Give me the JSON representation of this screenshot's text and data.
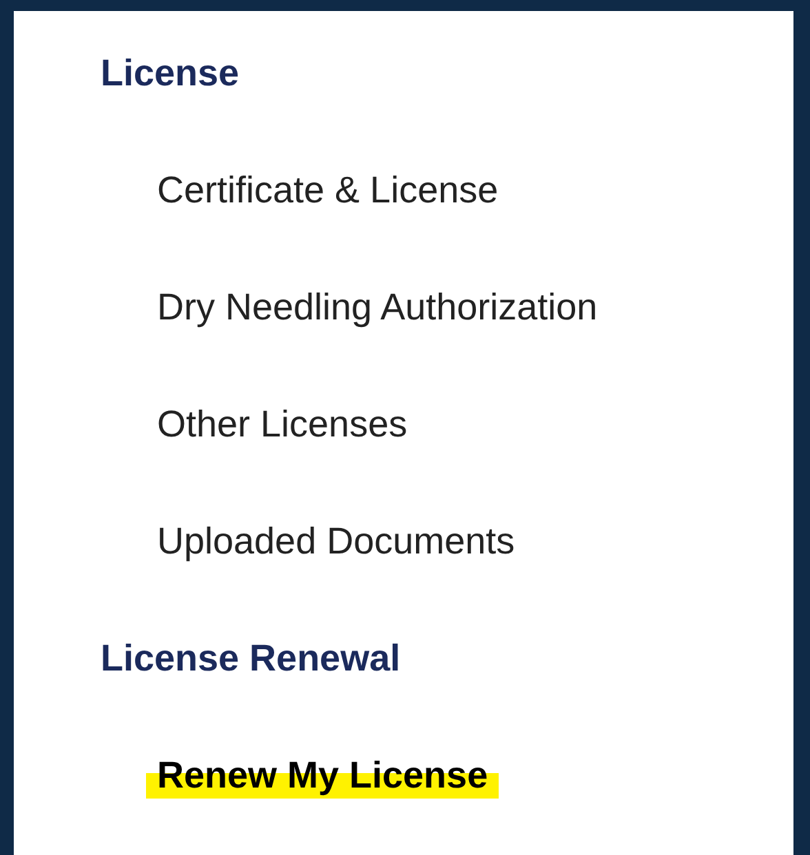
{
  "sections": [
    {
      "heading": "License",
      "items": [
        {
          "label": "Certificate & License",
          "selected": false,
          "highlighted": false
        },
        {
          "label": "Dry Needling Authorization",
          "selected": false,
          "highlighted": false
        },
        {
          "label": "Other Licenses",
          "selected": false,
          "highlighted": false
        },
        {
          "label": "Uploaded Documents",
          "selected": false,
          "highlighted": false
        }
      ]
    },
    {
      "heading": "License Renewal",
      "items": [
        {
          "label": "Renew My License",
          "selected": true,
          "highlighted": true
        }
      ]
    }
  ]
}
